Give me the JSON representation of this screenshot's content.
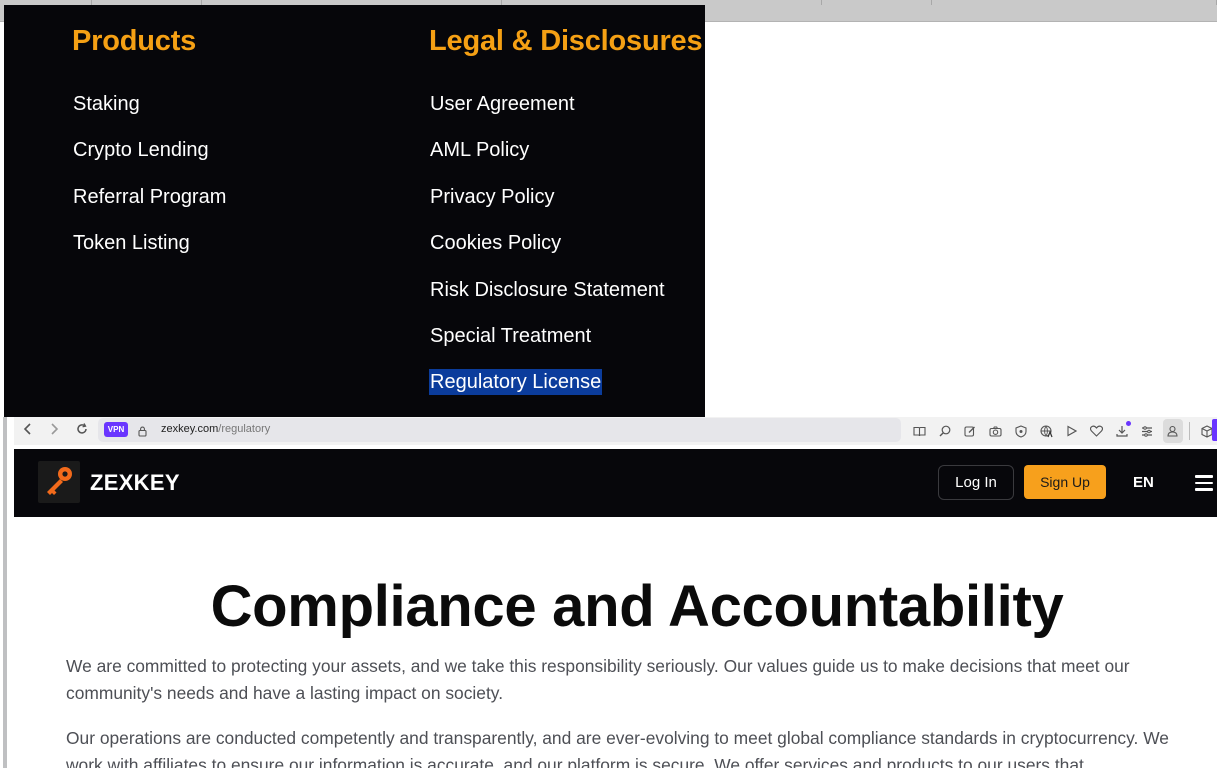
{
  "footer": {
    "products": {
      "heading": "Products",
      "items": [
        "Staking",
        "Crypto Lending",
        "Referral Program",
        "Token Listing"
      ]
    },
    "legal": {
      "heading": "Legal & Disclosures",
      "items": [
        "User Agreement",
        "AML Policy",
        "Privacy Policy",
        "Cookies Policy",
        "Risk Disclosure Statement",
        "Special Treatment",
        "Regulatory License"
      ],
      "selected_item": "Regulatory License"
    }
  },
  "browser": {
    "vpn_badge": "VPN",
    "url_domain": "zexkey.com",
    "url_path": "/regulatory",
    "toolbar_icons": [
      "reader-icon",
      "zoom-icon",
      "edit-icon",
      "camera-icon",
      "shield-icon",
      "translate-icon",
      "play-icon",
      "heart-icon",
      "download-icon",
      "settings-list-icon",
      "profile-icon",
      "cube-icon"
    ]
  },
  "site": {
    "brand": "ZEXKEY",
    "login_label": "Log In",
    "signup_label": "Sign Up",
    "language": "EN",
    "colors": {
      "accent": "#f7a01c",
      "header_bg": "#07070b",
      "selection": "#0b3c9c"
    }
  },
  "content": {
    "title": "Compliance and Accountability",
    "paragraph_1": "We are committed to protecting your assets, and we take this responsibility seriously. Our values guide us to make decisions that meet our community's needs and have a lasting impact on society.",
    "paragraph_2": "Our operations are conducted competently and transparently, and are ever-evolving to meet global compliance standards in cryptocurrency. We work with affiliates to ensure our information is accurate, and our platform is secure. We offer services and products to our users that"
  }
}
